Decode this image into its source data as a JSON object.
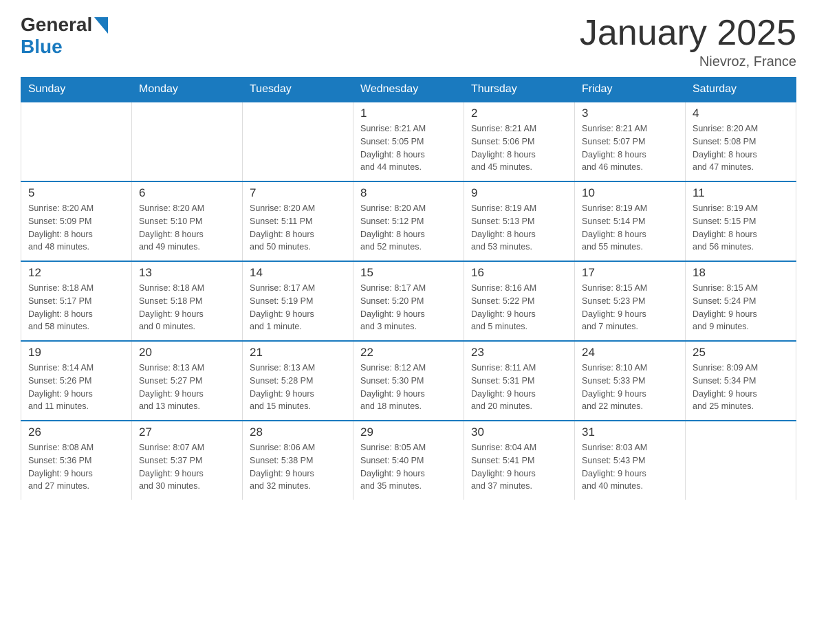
{
  "logo": {
    "general": "General",
    "arrow": "▲",
    "blue": "Blue"
  },
  "title": "January 2025",
  "location": "Nievroz, France",
  "days_header": [
    "Sunday",
    "Monday",
    "Tuesday",
    "Wednesday",
    "Thursday",
    "Friday",
    "Saturday"
  ],
  "weeks": [
    [
      {
        "day": "",
        "info": ""
      },
      {
        "day": "",
        "info": ""
      },
      {
        "day": "",
        "info": ""
      },
      {
        "day": "1",
        "info": "Sunrise: 8:21 AM\nSunset: 5:05 PM\nDaylight: 8 hours\nand 44 minutes."
      },
      {
        "day": "2",
        "info": "Sunrise: 8:21 AM\nSunset: 5:06 PM\nDaylight: 8 hours\nand 45 minutes."
      },
      {
        "day": "3",
        "info": "Sunrise: 8:21 AM\nSunset: 5:07 PM\nDaylight: 8 hours\nand 46 minutes."
      },
      {
        "day": "4",
        "info": "Sunrise: 8:20 AM\nSunset: 5:08 PM\nDaylight: 8 hours\nand 47 minutes."
      }
    ],
    [
      {
        "day": "5",
        "info": "Sunrise: 8:20 AM\nSunset: 5:09 PM\nDaylight: 8 hours\nand 48 minutes."
      },
      {
        "day": "6",
        "info": "Sunrise: 8:20 AM\nSunset: 5:10 PM\nDaylight: 8 hours\nand 49 minutes."
      },
      {
        "day": "7",
        "info": "Sunrise: 8:20 AM\nSunset: 5:11 PM\nDaylight: 8 hours\nand 50 minutes."
      },
      {
        "day": "8",
        "info": "Sunrise: 8:20 AM\nSunset: 5:12 PM\nDaylight: 8 hours\nand 52 minutes."
      },
      {
        "day": "9",
        "info": "Sunrise: 8:19 AM\nSunset: 5:13 PM\nDaylight: 8 hours\nand 53 minutes."
      },
      {
        "day": "10",
        "info": "Sunrise: 8:19 AM\nSunset: 5:14 PM\nDaylight: 8 hours\nand 55 minutes."
      },
      {
        "day": "11",
        "info": "Sunrise: 8:19 AM\nSunset: 5:15 PM\nDaylight: 8 hours\nand 56 minutes."
      }
    ],
    [
      {
        "day": "12",
        "info": "Sunrise: 8:18 AM\nSunset: 5:17 PM\nDaylight: 8 hours\nand 58 minutes."
      },
      {
        "day": "13",
        "info": "Sunrise: 8:18 AM\nSunset: 5:18 PM\nDaylight: 9 hours\nand 0 minutes."
      },
      {
        "day": "14",
        "info": "Sunrise: 8:17 AM\nSunset: 5:19 PM\nDaylight: 9 hours\nand 1 minute."
      },
      {
        "day": "15",
        "info": "Sunrise: 8:17 AM\nSunset: 5:20 PM\nDaylight: 9 hours\nand 3 minutes."
      },
      {
        "day": "16",
        "info": "Sunrise: 8:16 AM\nSunset: 5:22 PM\nDaylight: 9 hours\nand 5 minutes."
      },
      {
        "day": "17",
        "info": "Sunrise: 8:15 AM\nSunset: 5:23 PM\nDaylight: 9 hours\nand 7 minutes."
      },
      {
        "day": "18",
        "info": "Sunrise: 8:15 AM\nSunset: 5:24 PM\nDaylight: 9 hours\nand 9 minutes."
      }
    ],
    [
      {
        "day": "19",
        "info": "Sunrise: 8:14 AM\nSunset: 5:26 PM\nDaylight: 9 hours\nand 11 minutes."
      },
      {
        "day": "20",
        "info": "Sunrise: 8:13 AM\nSunset: 5:27 PM\nDaylight: 9 hours\nand 13 minutes."
      },
      {
        "day": "21",
        "info": "Sunrise: 8:13 AM\nSunset: 5:28 PM\nDaylight: 9 hours\nand 15 minutes."
      },
      {
        "day": "22",
        "info": "Sunrise: 8:12 AM\nSunset: 5:30 PM\nDaylight: 9 hours\nand 18 minutes."
      },
      {
        "day": "23",
        "info": "Sunrise: 8:11 AM\nSunset: 5:31 PM\nDaylight: 9 hours\nand 20 minutes."
      },
      {
        "day": "24",
        "info": "Sunrise: 8:10 AM\nSunset: 5:33 PM\nDaylight: 9 hours\nand 22 minutes."
      },
      {
        "day": "25",
        "info": "Sunrise: 8:09 AM\nSunset: 5:34 PM\nDaylight: 9 hours\nand 25 minutes."
      }
    ],
    [
      {
        "day": "26",
        "info": "Sunrise: 8:08 AM\nSunset: 5:36 PM\nDaylight: 9 hours\nand 27 minutes."
      },
      {
        "day": "27",
        "info": "Sunrise: 8:07 AM\nSunset: 5:37 PM\nDaylight: 9 hours\nand 30 minutes."
      },
      {
        "day": "28",
        "info": "Sunrise: 8:06 AM\nSunset: 5:38 PM\nDaylight: 9 hours\nand 32 minutes."
      },
      {
        "day": "29",
        "info": "Sunrise: 8:05 AM\nSunset: 5:40 PM\nDaylight: 9 hours\nand 35 minutes."
      },
      {
        "day": "30",
        "info": "Sunrise: 8:04 AM\nSunset: 5:41 PM\nDaylight: 9 hours\nand 37 minutes."
      },
      {
        "day": "31",
        "info": "Sunrise: 8:03 AM\nSunset: 5:43 PM\nDaylight: 9 hours\nand 40 minutes."
      },
      {
        "day": "",
        "info": ""
      }
    ]
  ]
}
